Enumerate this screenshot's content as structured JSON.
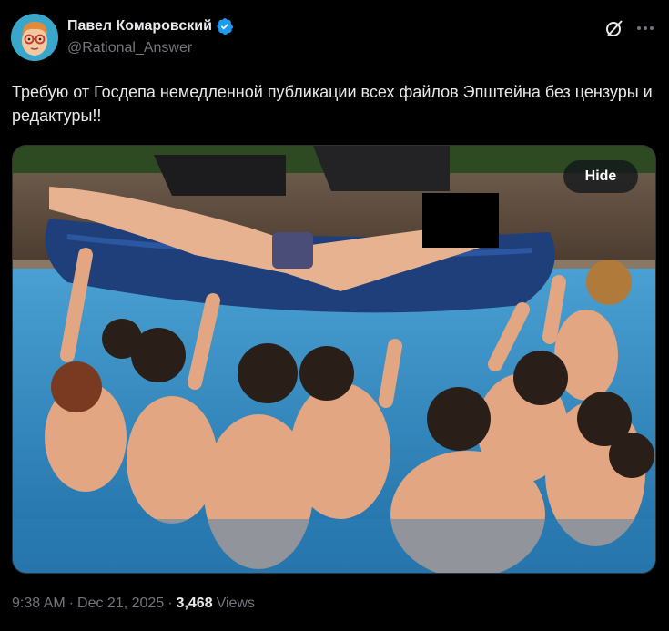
{
  "author": {
    "display_name": "Павел Комаровский",
    "handle": "@Rational_Answer",
    "verified": true,
    "verified_color": "#1d9bf0"
  },
  "tweet": {
    "text": "Требую от Госдепа немедленной публикации всех файлов Эпштейна без цензуры и редактуры!!"
  },
  "media": {
    "hide_label": "Hide"
  },
  "meta": {
    "time": "9:38 AM",
    "separator": "·",
    "date": "Dec 21, 2025",
    "views_count": "3,468",
    "views_label": "Views"
  },
  "icons": {
    "grok": "grok-icon",
    "more": "more-icon",
    "verified": "verified-badge-icon"
  },
  "colors": {
    "background": "#000000",
    "text_primary": "#e7e9ea",
    "text_secondary": "#71767b",
    "pool_water": "#3f8fc4"
  }
}
